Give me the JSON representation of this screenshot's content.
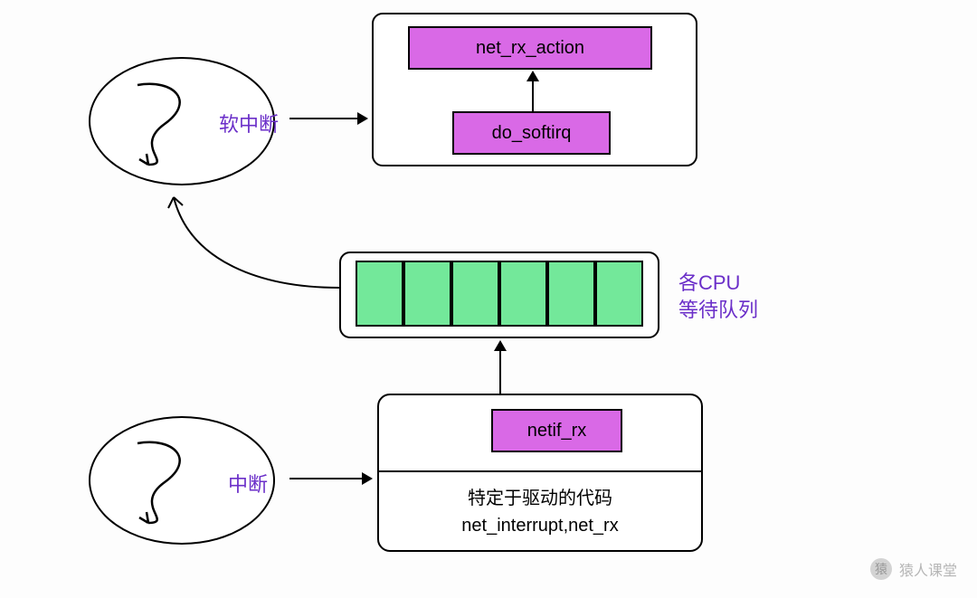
{
  "labels": {
    "softirq": "软中断",
    "irq": "中断",
    "cpu_queue_l1": "各CPU",
    "cpu_queue_l2": "等待队列"
  },
  "functions": {
    "net_rx_action": "net_rx_action",
    "do_softirq": "do_softirq",
    "netif_rx": "netif_rx"
  },
  "driver_text": {
    "line1": "特定于驱动的代码",
    "line2": "net_interrupt,net_rx"
  },
  "watermark": {
    "text": "猿人课堂",
    "icon": "猿"
  },
  "colors": {
    "func_fill": "#d969e6",
    "queue_fill": "#73e89a",
    "label_text": "#6b2fc9"
  }
}
